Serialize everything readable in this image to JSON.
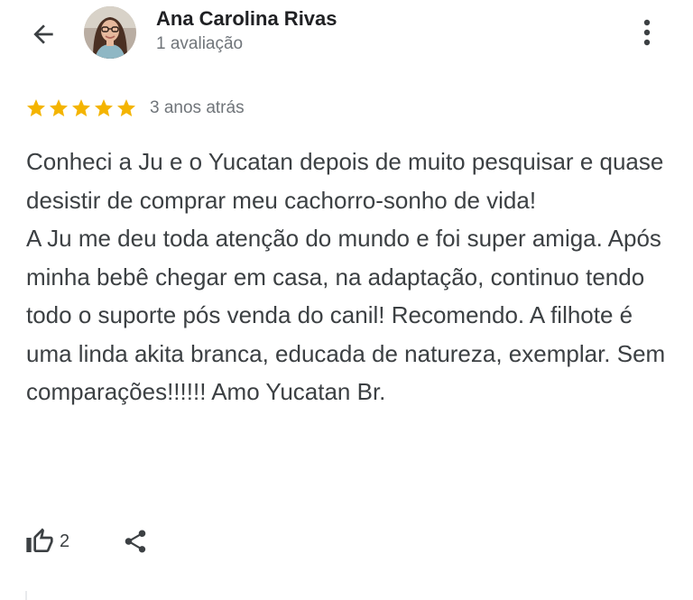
{
  "reviewer": {
    "name": "Ana Carolina Rivas",
    "review_count": "1 avaliação"
  },
  "review": {
    "rating": 5,
    "max_rating": 5,
    "star_color": "#f4b400",
    "time_ago": "3 anos atrás",
    "text": "Conheci a Ju e o Yucatan depois de muito pesquisar e quase desistir de comprar meu cachorro-sonho de vida!\nA Ju me deu toda atenção do mundo e foi super amiga. Após minha bebê chegar em casa, na adaptação, continuo tendo todo o suporte pós venda do canil! Recomendo. A filhote é uma linda akita branca, educada de natureza, exemplar. Sem comparações!!!!!! Amo Yucatan Br."
  },
  "actions": {
    "like_count": "2"
  },
  "icons": {
    "back": "arrow-back-icon",
    "more": "more-vert-icon",
    "like": "thumb-up-icon",
    "share": "share-icon"
  }
}
